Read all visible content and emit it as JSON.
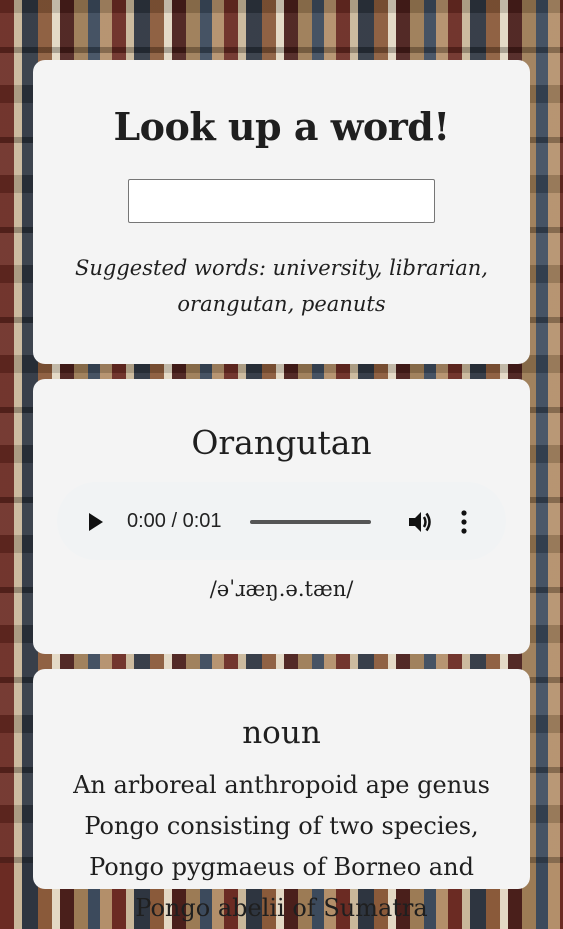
{
  "search": {
    "title": "Look up a word!",
    "input_value": "",
    "suggested": "Suggested words: university, librarian, orangutan, peanuts"
  },
  "word": {
    "name": "Orangutan",
    "phonetic": "/əˈɹæŋ.ə.tæn/"
  },
  "audio": {
    "time": "0:00 / 0:01",
    "progress": 0
  },
  "definition": {
    "part_of_speech": "noun",
    "text": "An arboreal anthropoid ape genus Pongo consisting of two species, Pongo pygmaeus of Borneo and Pongo abelii of Sumatra"
  }
}
